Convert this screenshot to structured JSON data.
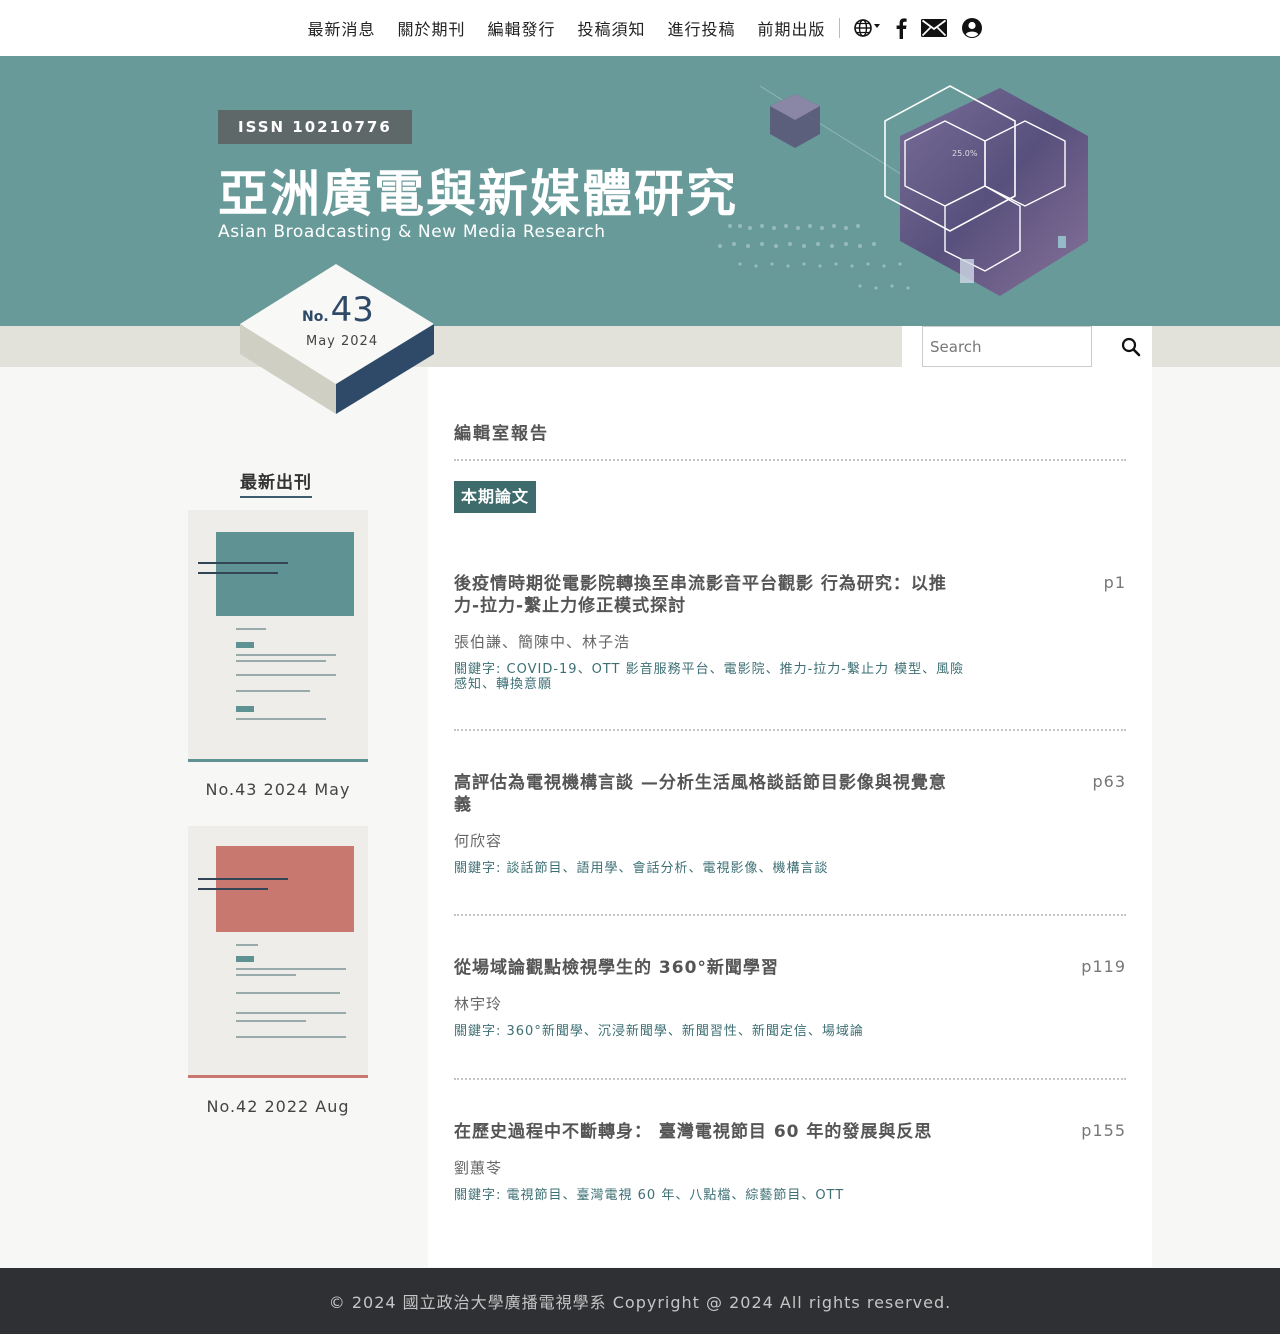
{
  "nav": {
    "items": [
      "最新消息",
      "關於期刊",
      "編輯發行",
      "投稿須知",
      "進行投稿",
      "前期出版"
    ],
    "icons": [
      "globe-icon",
      "facebook-icon",
      "mail-icon",
      "user-icon"
    ]
  },
  "hero": {
    "issn": "ISSN 10210776",
    "title_zh": "亞洲廣電與新媒體研究",
    "title_en": "Asian Broadcasting & New Media Research"
  },
  "issue": {
    "no_prefix": "No.",
    "number": "43",
    "date": "May 2024"
  },
  "search": {
    "placeholder": "Search"
  },
  "sidebar": {
    "title": "最新出刊",
    "covers": [
      {
        "label": "No.43 2024 May",
        "color": "#5f9292"
      },
      {
        "label": "No.42 2022 Aug",
        "color": "#c9786f"
      }
    ]
  },
  "main": {
    "section_title": "編輯室報告",
    "tag": "本期論文",
    "articles": [
      {
        "title": "後疫情時期從電影院轉換至串流影音平台觀影 行為研究：以推力-拉力-繫止力修正模式探討",
        "page": "p1",
        "authors": "張伯謙、簡陳中、林子浩",
        "keywords": "關鍵字: COVID-19、OTT 影音服務平台、電影院、推力-拉力-繫止力 模型、風險感知、轉換意願"
      },
      {
        "title": "高評估為電視機構言談 —分析生活風格談話節目影像與視覺意義",
        "page": "p63",
        "authors": "何欣容",
        "keywords": "關鍵字: 談話節目、語用學、會話分析、電視影像、機構言談"
      },
      {
        "title": "從場域論觀點檢視學生的 360°新聞學習",
        "page": "p119",
        "authors": "林宇玲",
        "keywords": "關鍵字: 360°新聞學、沉浸新聞學、新聞習性、新聞定信、場域論"
      },
      {
        "title": "在歷史過程中不斷轉身： 臺灣電視節目 60 年的發展與反思",
        "page": "p155",
        "authors": "劉蕙苓",
        "keywords": "關鍵字: 電視節目、臺灣電視 60 年、八點檔、綜藝節目、OTT"
      }
    ]
  },
  "footer": {
    "text": "© 2024 國立政治大學廣播電視學系 Copyright @ 2024 All rights reserved."
  },
  "colors": {
    "hero": "#689a9a",
    "band": "#e2e1da",
    "tag": "#3e6b6c",
    "cube_dark": "#2e4a68",
    "footer": "#2f3033"
  }
}
